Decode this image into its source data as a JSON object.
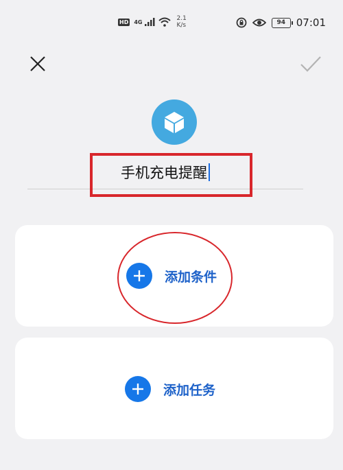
{
  "status_bar": {
    "hd": "HD",
    "network": "4G",
    "speed_value": "2.1",
    "speed_unit": "K/s",
    "battery": "94",
    "time": "07:01",
    "icons": [
      "signal-icon",
      "wifi-icon",
      "rotation-lock-icon",
      "eye-icon",
      "battery-icon"
    ]
  },
  "header": {
    "close_icon": "close-icon",
    "confirm_icon": "check-icon"
  },
  "app_icon": {
    "icon": "cube-icon",
    "color": "#44a9e0"
  },
  "name_input": {
    "value": "手机充电提醒"
  },
  "cards": {
    "condition": {
      "label": "添加条件",
      "icon": "plus-icon"
    },
    "task": {
      "label": "添加任务",
      "icon": "plus-icon"
    }
  },
  "colors": {
    "accent": "#1677e8",
    "label_blue": "#1e62c9",
    "annotation_red": "#d8262b"
  }
}
